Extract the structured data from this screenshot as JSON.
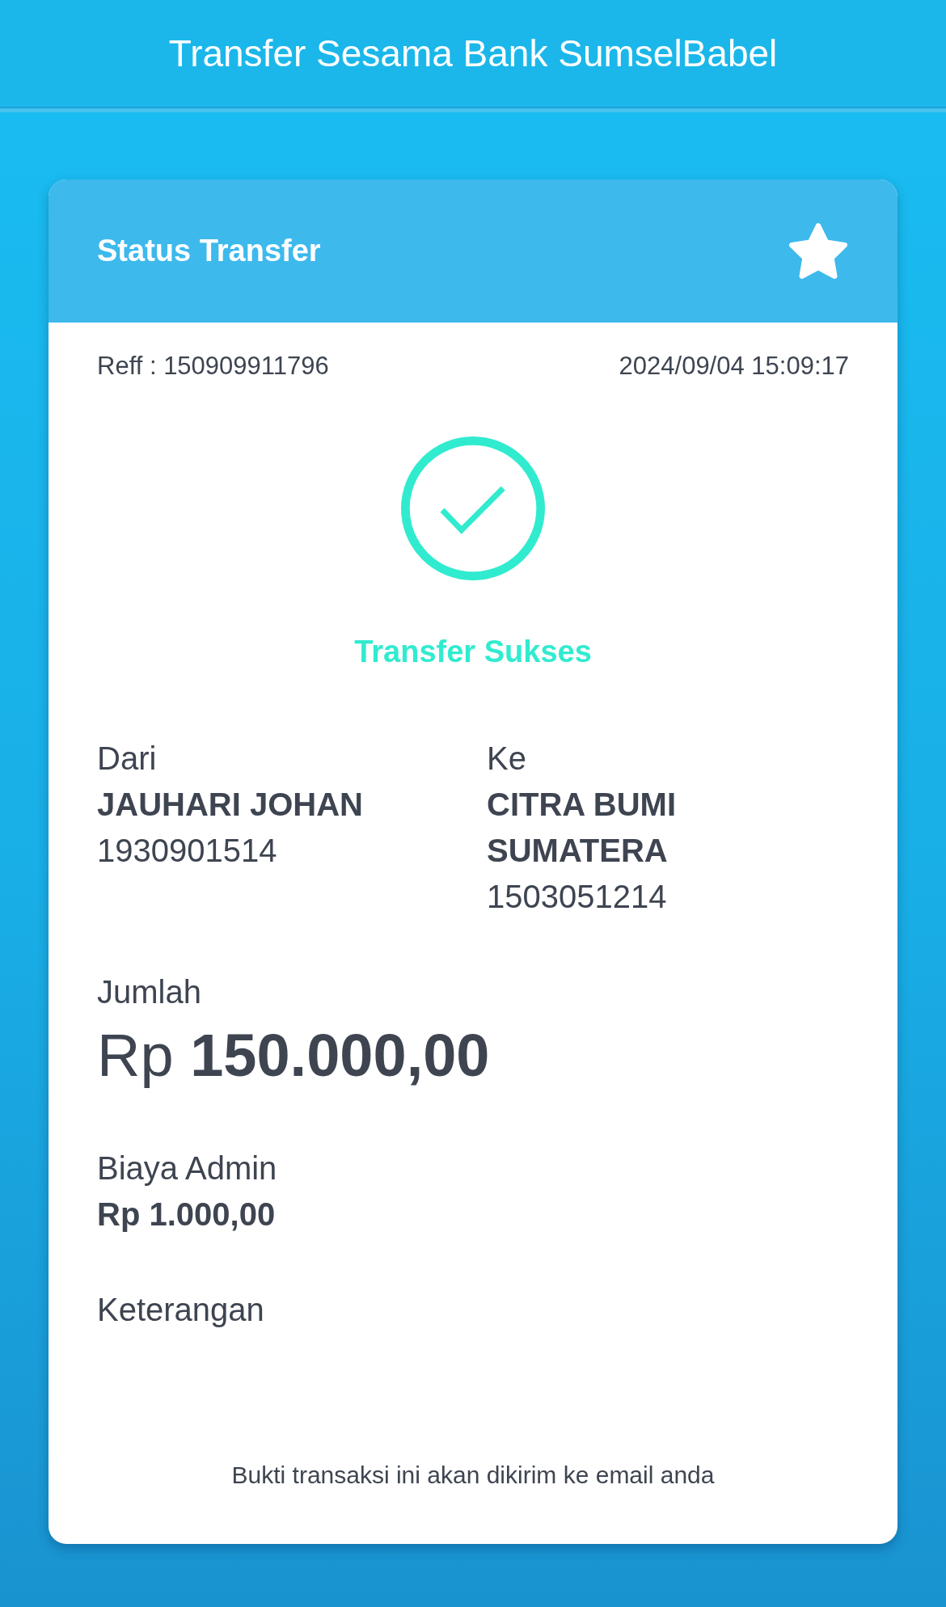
{
  "header": {
    "title": "Transfer Sesama Bank SumselBabel"
  },
  "card": {
    "title": "Status Transfer",
    "reference": "Reff : 150909911796",
    "datetime": "2024/09/04 15:09:17",
    "status": {
      "kind": "success",
      "label": "Transfer Sukses"
    },
    "from": {
      "label": "Dari",
      "name": "JAUHARI JOHAN",
      "account": "1930901514"
    },
    "to": {
      "label": "Ke",
      "name": "CITRA BUMI SUMATERA",
      "account": "1503051214"
    },
    "amount": {
      "label": "Jumlah",
      "value": "Rp **150.000,00**"
    },
    "admin_fee": {
      "label": "Biaya Admin",
      "value": "Rp 1.000,00"
    },
    "note": {
      "label": "Keterangan"
    },
    "footer": "Bukti transaksi ini akan dikirim ke email anda"
  }
}
